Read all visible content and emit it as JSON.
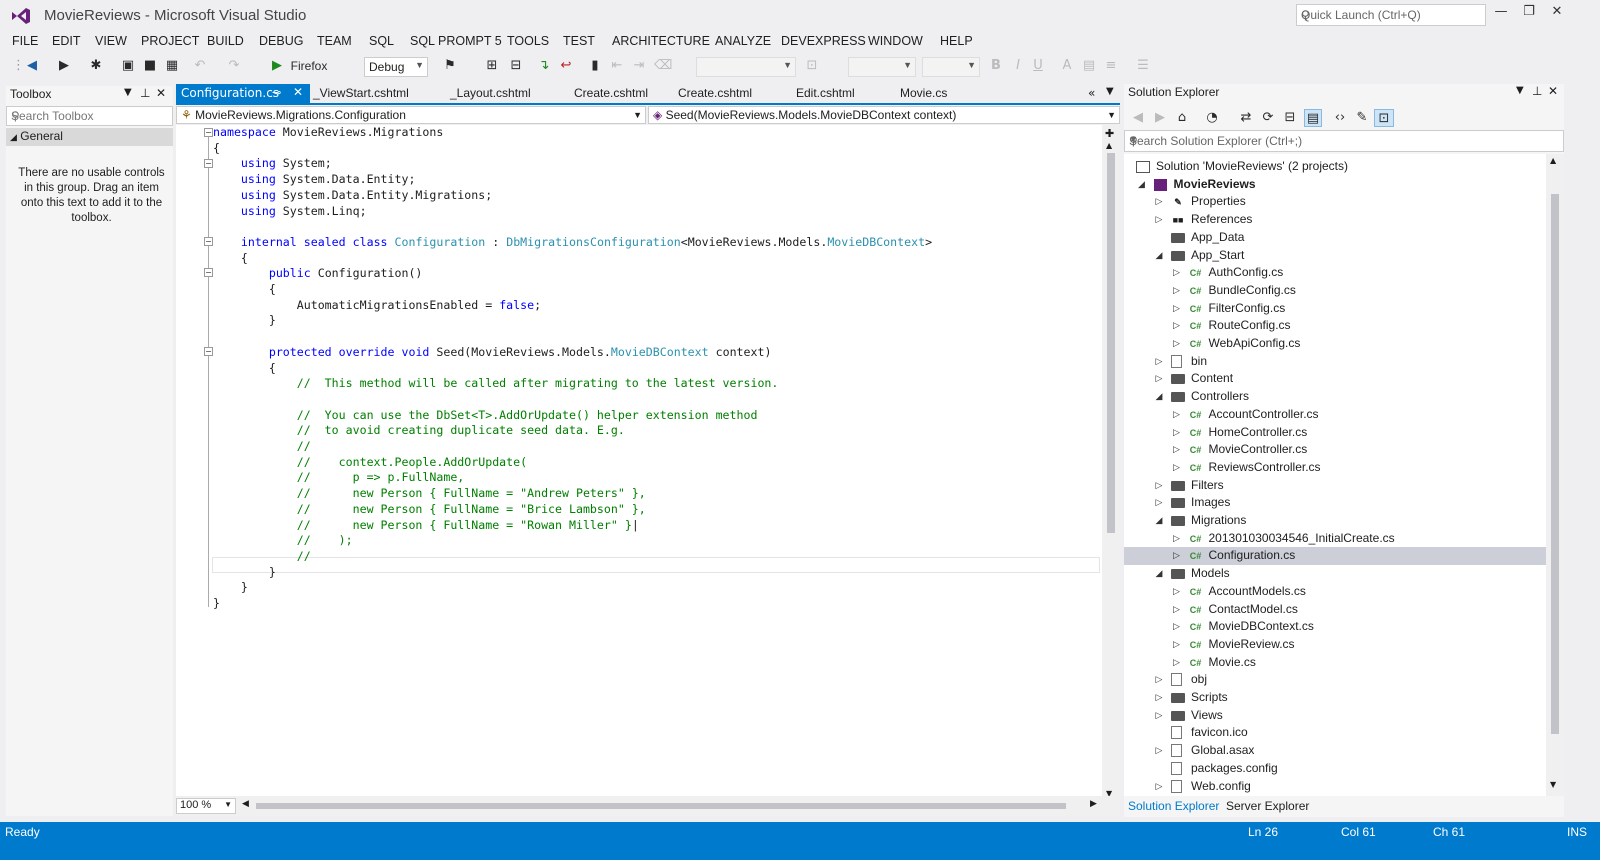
{
  "window": {
    "title": "MovieReviews - Microsoft Visual Studio",
    "quick_launch_placeholder": "Quick Launch (Ctrl+Q)"
  },
  "menu": [
    "FILE",
    "EDIT",
    "VIEW",
    "PROJECT",
    "BUILD",
    "DEBUG",
    "TEAM",
    "SQL",
    "SQL PROMPT 5",
    "TOOLS",
    "TEST",
    "ARCHITECTURE",
    "ANALYZE",
    "DEVEXPRESS",
    "WINDOW",
    "HELP"
  ],
  "toolbar": {
    "run_target": "Firefox",
    "configuration": "Debug"
  },
  "toolbox": {
    "title": "Toolbox",
    "search_placeholder": "Search Toolbox",
    "group": "General",
    "empty_message": "There are no usable controls in this group. Drag an item onto this text to add it to the toolbox."
  },
  "editor": {
    "tabs": [
      "Configuration.cs",
      "_ViewStart.cshtml",
      "_Layout.cshtml",
      "Create.cshtml",
      "Edit.cshtml",
      "Movie.cs"
    ],
    "nav_left": "MovieReviews.Migrations.Configuration",
    "nav_right": "Seed(MovieReviews.Models.MovieDBContext context)",
    "zoom": "100 %"
  },
  "solution_explorer": {
    "title": "Solution Explorer",
    "search_placeholder": "Search Solution Explorer (Ctrl+;)",
    "bottom_tabs": [
      "Solution Explorer",
      "Server Explorer"
    ],
    "nodes": [
      {
        "label": "Solution 'MovieReviews' (2 projects)",
        "icon": "solution-icon"
      },
      {
        "label": "MovieReviews",
        "icon": "project-icon"
      },
      {
        "label": "Properties",
        "icon": "wrench-icon"
      },
      {
        "label": "References",
        "icon": "references-icon"
      },
      {
        "label": "App_Data",
        "icon": "folder-icon"
      },
      {
        "label": "App_Start",
        "icon": "folder-icon"
      },
      {
        "label": "AuthConfig.cs",
        "icon": "csharp-file-icon"
      },
      {
        "label": "BundleConfig.cs",
        "icon": "csharp-file-icon"
      },
      {
        "label": "FilterConfig.cs",
        "icon": "csharp-file-icon"
      },
      {
        "label": "RouteConfig.cs",
        "icon": "csharp-file-icon"
      },
      {
        "label": "WebApiConfig.cs",
        "icon": "csharp-file-icon"
      },
      {
        "label": "bin",
        "icon": "dashed-folder-icon"
      },
      {
        "label": "Content",
        "icon": "folder-icon"
      },
      {
        "label": "Controllers",
        "icon": "folder-icon"
      },
      {
        "label": "AccountController.cs",
        "icon": "csharp-file-icon"
      },
      {
        "label": "HomeController.cs",
        "icon": "csharp-file-icon"
      },
      {
        "label": "MovieController.cs",
        "icon": "csharp-file-icon"
      },
      {
        "label": "ReviewsController.cs",
        "icon": "csharp-file-icon"
      },
      {
        "label": "Filters",
        "icon": "folder-icon"
      },
      {
        "label": "Images",
        "icon": "folder-icon"
      },
      {
        "label": "Migrations",
        "icon": "folder-icon"
      },
      {
        "label": "201301030034546_InitialCreate.cs",
        "icon": "csharp-file-icon"
      },
      {
        "label": "Configuration.cs",
        "icon": "csharp-file-icon"
      },
      {
        "label": "Models",
        "icon": "folder-icon"
      },
      {
        "label": "AccountModels.cs",
        "icon": "csharp-file-icon"
      },
      {
        "label": "ContactModel.cs",
        "icon": "csharp-file-icon"
      },
      {
        "label": "MovieDBContext.cs",
        "icon": "csharp-file-icon"
      },
      {
        "label": "MovieReview.cs",
        "icon": "csharp-file-icon"
      },
      {
        "label": "Movie.cs",
        "icon": "csharp-file-icon"
      },
      {
        "label": "obj",
        "icon": "dashed-folder-icon"
      },
      {
        "label": "Scripts",
        "icon": "folder-icon"
      },
      {
        "label": "Views",
        "icon": "folder-icon"
      },
      {
        "label": "favicon.ico",
        "icon": "file-icon"
      },
      {
        "label": "Global.asax",
        "icon": "file-icon"
      },
      {
        "label": "packages.config",
        "icon": "file-icon"
      },
      {
        "label": "Web.config",
        "icon": "file-icon"
      }
    ]
  },
  "status": {
    "state": "Ready",
    "line": "Ln 26",
    "col": "Col 61",
    "ch": "Ch 61",
    "mode": "INS"
  },
  "colors": {
    "accent": "#007acc",
    "keyword": "#0000ff",
    "type": "#2b91af",
    "comment": "#008000"
  }
}
